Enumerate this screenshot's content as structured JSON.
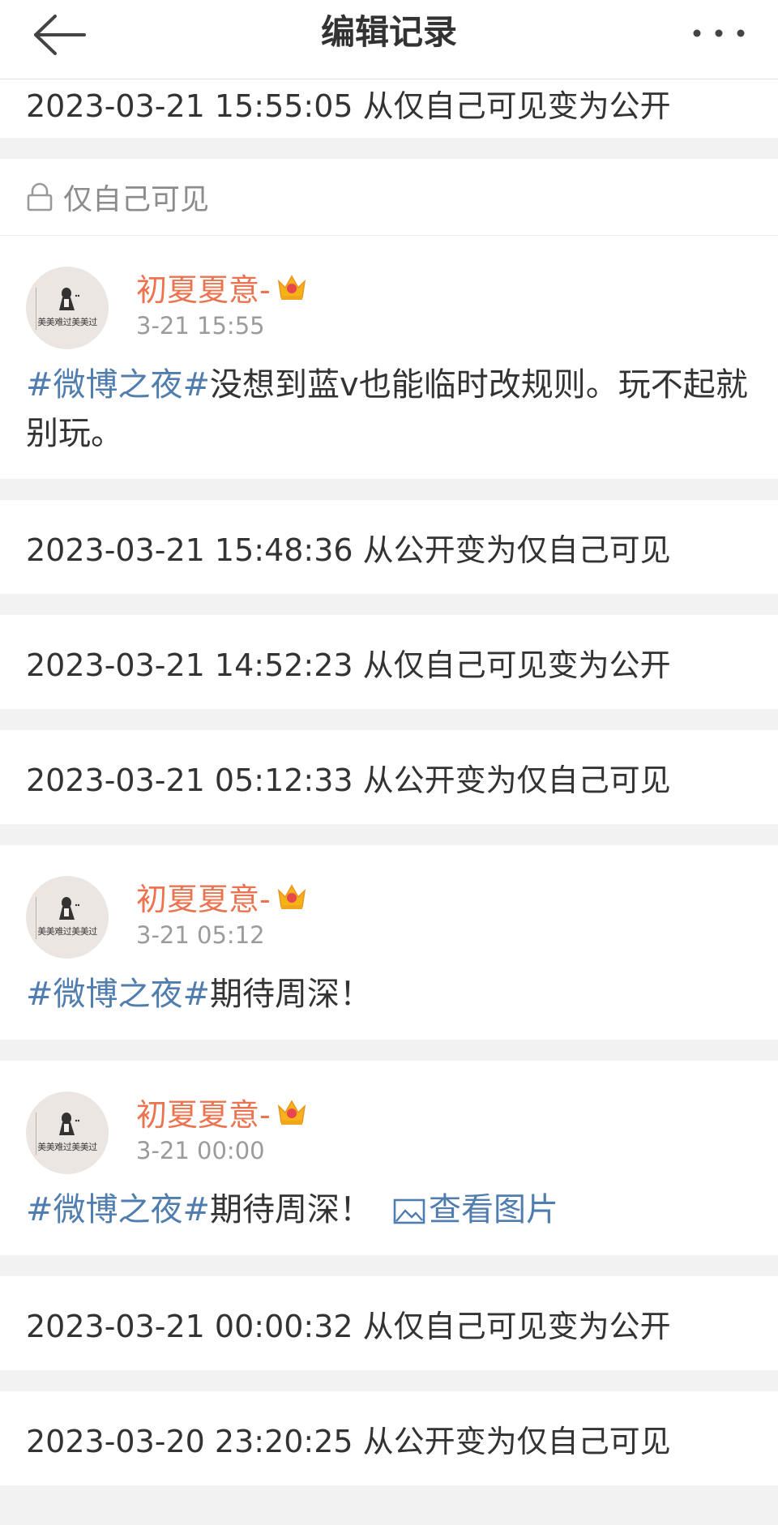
{
  "navbar": {
    "title": "编辑记录",
    "back_icon": "back-arrow-icon",
    "more_icon": "more-dots-icon"
  },
  "entries": {
    "e0": "2023-03-21 15:55:05 从仅自己可见变为公开",
    "e1": "2023-03-21 15:48:36 从公开变为仅自己可见",
    "e2": "2023-03-21 14:52:23 从仅自己可见变为公开",
    "e3": "2023-03-21 05:12:33 从公开变为仅自己可见",
    "e4": "2023-03-21 00:00:32 从仅自己可见变为公开",
    "e5": "2023-03-20 23:20:25 从公开变为仅自己可见"
  },
  "visibility": {
    "label": "仅自己可见",
    "icon": "lock-icon"
  },
  "posts": {
    "p1": {
      "author": "初夏夏意-",
      "time": "3-21 15:55",
      "topic": "#微博之夜#",
      "text": "没想到蓝v也能临时改规则。玩不起就别玩。"
    },
    "p2": {
      "author": "初夏夏意-",
      "time": "3-21 05:12",
      "topic": "#微博之夜#",
      "text": "期待周深！"
    },
    "p3": {
      "author": "初夏夏意-",
      "time": "3-21 00:00",
      "topic": "#微博之夜#",
      "text": "期待周深！",
      "view_image": "查看图片"
    }
  },
  "avatar_caption": "美美难过美美过",
  "colors": {
    "author": "#eb7350",
    "topic_link": "#507daf",
    "divider": "#f2f2f2"
  }
}
